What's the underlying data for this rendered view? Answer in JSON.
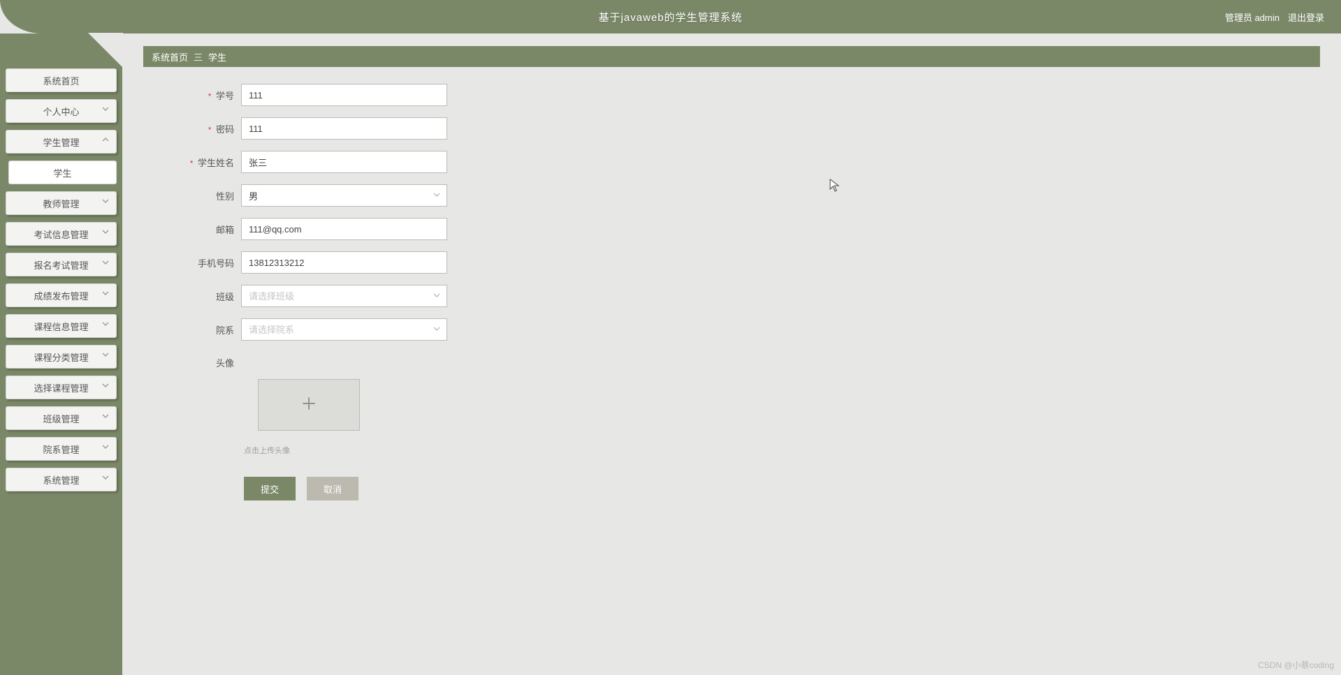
{
  "header": {
    "title": "基于javaweb的学生管理系统",
    "role_label": "管理员 admin",
    "logout_label": "退出登录"
  },
  "sidebar": {
    "items": [
      {
        "label": "系统首页",
        "expandable": false
      },
      {
        "label": "个人中心",
        "expandable": true,
        "collapsed": true
      },
      {
        "label": "学生管理",
        "expandable": true,
        "collapsed": false
      },
      {
        "label": "学生",
        "sub": true
      },
      {
        "label": "教师管理",
        "expandable": true,
        "collapsed": true
      },
      {
        "label": "考试信息管理",
        "expandable": true,
        "collapsed": true
      },
      {
        "label": "报名考试管理",
        "expandable": true,
        "collapsed": true
      },
      {
        "label": "成绩发布管理",
        "expandable": true,
        "collapsed": true
      },
      {
        "label": "课程信息管理",
        "expandable": true,
        "collapsed": true
      },
      {
        "label": "课程分类管理",
        "expandable": true,
        "collapsed": true
      },
      {
        "label": "选择课程管理",
        "expandable": true,
        "collapsed": true
      },
      {
        "label": "班级管理",
        "expandable": true,
        "collapsed": true
      },
      {
        "label": "院系管理",
        "expandable": true,
        "collapsed": true
      },
      {
        "label": "系统管理",
        "expandable": true,
        "collapsed": true
      }
    ]
  },
  "breadcrumb": {
    "root": "系统首页",
    "separator": "三",
    "current": "学生"
  },
  "form": {
    "fields": {
      "student_no": {
        "label": "学号",
        "value": "111",
        "required": true
      },
      "password": {
        "label": "密码",
        "value": "111",
        "required": true
      },
      "student_name": {
        "label": "学生姓名",
        "value": "张三",
        "required": true
      },
      "gender": {
        "label": "性别",
        "value": "男",
        "required": false,
        "type": "select"
      },
      "email": {
        "label": "邮箱",
        "value": "111@qq.com",
        "required": false
      },
      "phone": {
        "label": "手机号码",
        "value": "13812313212",
        "required": false
      },
      "class": {
        "label": "班级",
        "value": "",
        "placeholder": "请选择班级",
        "required": false,
        "type": "select"
      },
      "department": {
        "label": "院系",
        "value": "",
        "placeholder": "请选择院系",
        "required": false,
        "type": "select"
      },
      "avatar": {
        "label": "头像"
      }
    },
    "upload_hint": "点击上传头像",
    "buttons": {
      "submit": "提交",
      "cancel": "取消"
    }
  },
  "watermark": "CSDN @小蔡coding"
}
